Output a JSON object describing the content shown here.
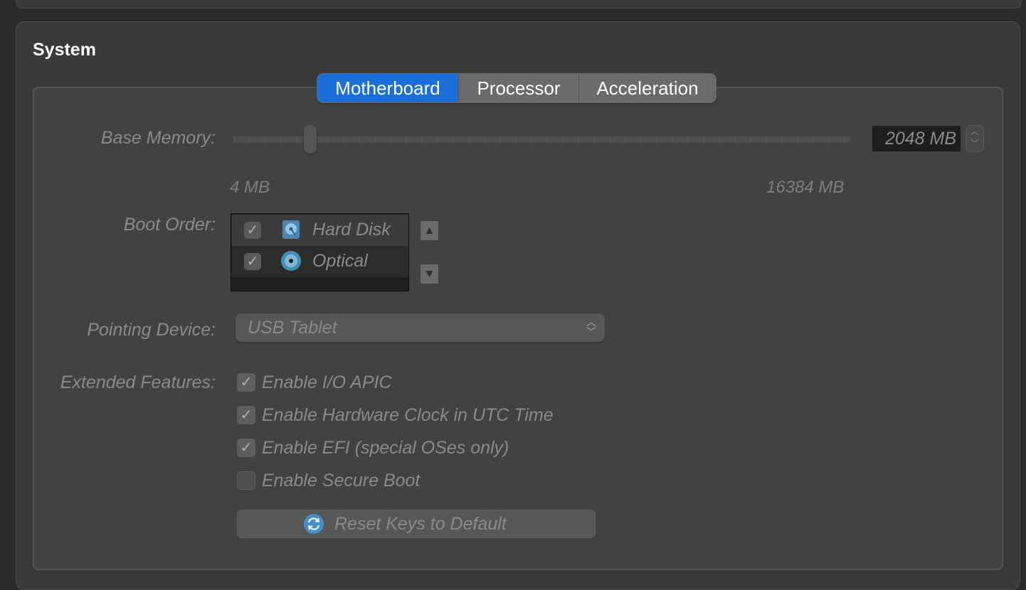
{
  "section": {
    "title": "System"
  },
  "tabs": [
    {
      "label": "Motherboard",
      "active": true
    },
    {
      "label": "Processor",
      "active": false
    },
    {
      "label": "Acceleration",
      "active": false
    }
  ],
  "base_memory": {
    "label": "Base Memory:",
    "value": "2048 MB",
    "min_label": "4 MB",
    "max_label": "16384 MB",
    "value_mb": 2048,
    "min_mb": 4,
    "max_mb": 16384
  },
  "boot_order": {
    "label": "Boot Order:",
    "items": [
      {
        "label": "Hard Disk",
        "checked": true,
        "icon": "hard-disk-icon"
      },
      {
        "label": "Optical",
        "checked": true,
        "icon": "optical-disc-icon"
      }
    ],
    "move_up_icon": "arrow-up-icon",
    "move_down_icon": "arrow-down-icon"
  },
  "pointing_device": {
    "label": "Pointing Device:",
    "value": "USB Tablet"
  },
  "extended_features": {
    "label": "Extended Features:",
    "items": [
      {
        "label": "Enable I/O APIC",
        "checked": true
      },
      {
        "label": "Enable Hardware Clock in UTC Time",
        "checked": true
      },
      {
        "label": "Enable EFI (special OSes only)",
        "checked": true
      },
      {
        "label": "Enable Secure Boot",
        "checked": false
      }
    ]
  },
  "reset_button": {
    "label": "Reset Keys to Default",
    "icon": "refresh-icon"
  },
  "colors": {
    "accent": "#1a6fd8",
    "panel": "#3a3a3a",
    "group": "#424242",
    "disabled_text": "#8a8a8a"
  }
}
